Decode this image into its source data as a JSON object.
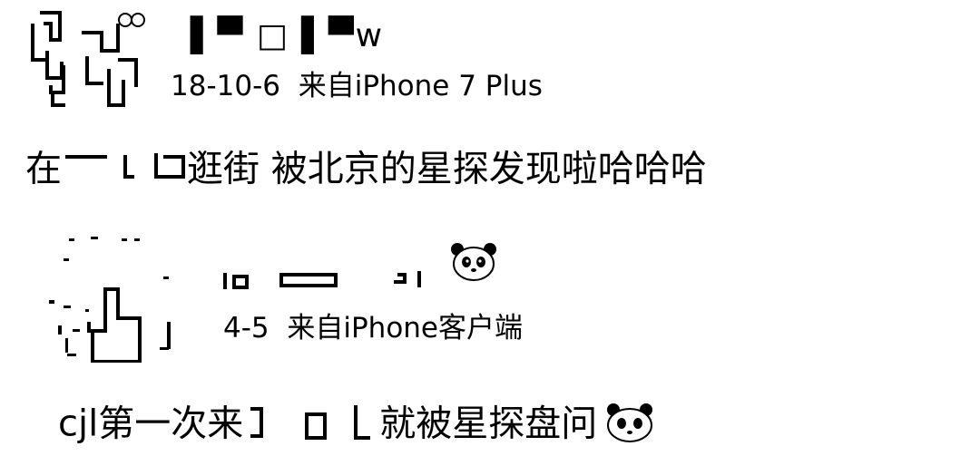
{
  "posts": [
    {
      "author": "▌▀ □ ▌▀w",
      "timestamp": "18-10-6",
      "source": "来自iPhone 7 Plus",
      "text_before": "在",
      "text_after": "逛街 被北京的星探发现啦哈哈哈"
    },
    {
      "author": "",
      "timestamp": "4-5",
      "source": "来自iPhone客户端",
      "text_before": "cjl第一次来",
      "text_after": "就被星探盘问"
    }
  ],
  "icons": {
    "post2_name_emoji": "panda-face-icon",
    "post2_content_emoji": "panda-face-icon"
  }
}
